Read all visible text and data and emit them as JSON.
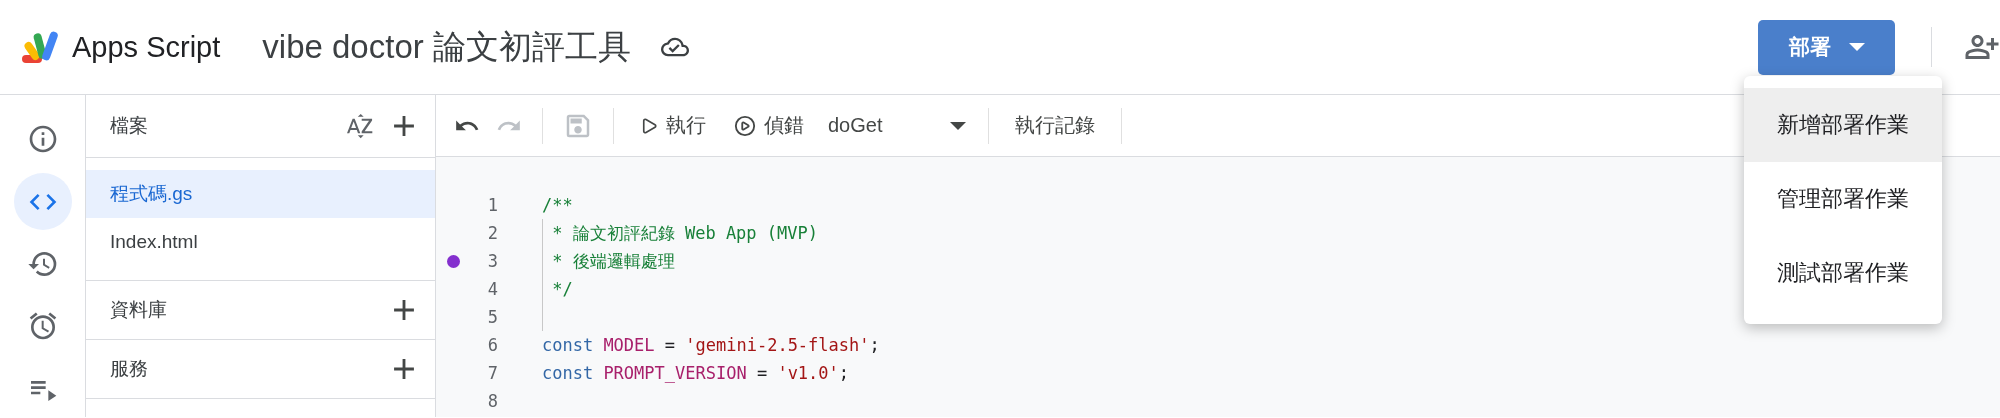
{
  "header": {
    "app_name": "Apps Script",
    "title": "vibe doctor 論文初評工具"
  },
  "deploy_button": {
    "label": "部署"
  },
  "deploy_menu": [
    {
      "label": "新增部署作業",
      "selected": true
    },
    {
      "label": "管理部署作業",
      "selected": false
    },
    {
      "label": "測試部署作業",
      "selected": false
    }
  ],
  "rail": [
    {
      "kind": "info",
      "selected": false
    },
    {
      "kind": "editor",
      "selected": true
    },
    {
      "kind": "history",
      "selected": false
    },
    {
      "kind": "triggers",
      "selected": false
    },
    {
      "kind": "executions",
      "selected": false
    }
  ],
  "files_panel": {
    "title": "檔案",
    "files": [
      {
        "name": "程式碼.gs",
        "selected": true
      },
      {
        "name": "Index.html",
        "selected": false
      }
    ],
    "sections": [
      {
        "label": "資料庫"
      },
      {
        "label": "服務"
      }
    ]
  },
  "toolbar": {
    "history_buttons": [
      {
        "kind": "undo",
        "disabled": false
      },
      {
        "kind": "redo",
        "disabled": true
      }
    ],
    "save": {
      "disabled": true
    },
    "run_label": "執行",
    "debug_label": "偵錯",
    "function_name": "doGet",
    "log_label": "執行記錄"
  },
  "editor": {
    "lines": [
      {
        "number": "1",
        "breakpoint": false,
        "guide": false,
        "tokens": [
          {
            "kind": "comment",
            "text": "/**"
          }
        ]
      },
      {
        "number": "2",
        "breakpoint": false,
        "guide": true,
        "tokens": [
          {
            "kind": "comment",
            "text": " * 論文初評紀錄 Web App (MVP)"
          }
        ]
      },
      {
        "number": "3",
        "breakpoint": true,
        "guide": true,
        "tokens": [
          {
            "kind": "comment",
            "text": " * 後端邏輯處理"
          }
        ]
      },
      {
        "number": "4",
        "breakpoint": false,
        "guide": true,
        "tokens": [
          {
            "kind": "comment",
            "text": " */"
          }
        ]
      },
      {
        "number": "5",
        "breakpoint": false,
        "guide": true
      },
      {
        "number": "6",
        "breakpoint": false,
        "guide": false,
        "tokens": [
          {
            "kind": "keyword",
            "text": "const"
          },
          {
            "kind": "variable",
            "text": "MODEL"
          },
          {
            "kind": "plain",
            "text": " = "
          },
          {
            "kind": "string",
            "text": "'gemini-2.5-flash'"
          },
          {
            "kind": "plain",
            "text": ";"
          }
        ]
      },
      {
        "number": "7",
        "breakpoint": false,
        "guide": false,
        "tokens": [
          {
            "kind": "keyword",
            "text": "const"
          },
          {
            "kind": "variable",
            "text": "PROMPT_VERSION"
          },
          {
            "kind": "plain",
            "text": " = "
          },
          {
            "kind": "string",
            "text": "'v1.0'"
          },
          {
            "kind": "plain",
            "text": ";"
          }
        ]
      },
      {
        "number": "8",
        "breakpoint": false,
        "guide": false
      }
    ]
  }
}
